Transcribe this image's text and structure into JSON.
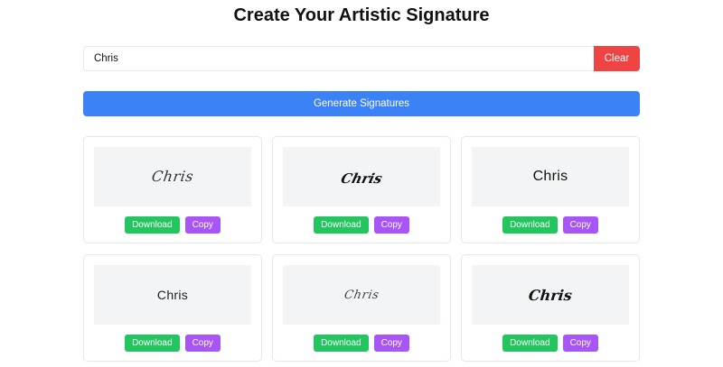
{
  "page": {
    "title": "Create Your Artistic Signature"
  },
  "form": {
    "name_value": "Chris",
    "clear_label": "Clear",
    "generate_label": "Generate Signatures"
  },
  "signatures": [
    {
      "text": "Chris",
      "download_label": "Download",
      "copy_label": "Copy"
    },
    {
      "text": "Chris",
      "download_label": "Download",
      "copy_label": "Copy"
    },
    {
      "text": "Chris",
      "download_label": "Download",
      "copy_label": "Copy"
    },
    {
      "text": "Chris",
      "download_label": "Download",
      "copy_label": "Copy"
    },
    {
      "text": "Chris",
      "download_label": "Download",
      "copy_label": "Copy"
    },
    {
      "text": "Chris",
      "download_label": "Download",
      "copy_label": "Copy"
    }
  ],
  "colors": {
    "clear": "#ef4444",
    "generate": "#3b82f6",
    "download": "#22c55e",
    "copy": "#a855f7",
    "preview_bg": "#f3f4f6"
  }
}
